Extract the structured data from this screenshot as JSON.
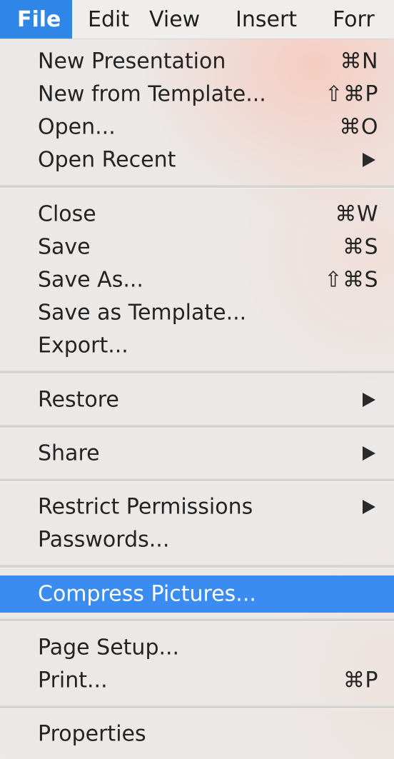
{
  "menubar": {
    "items": [
      "File",
      "Edit",
      "View",
      "Insert",
      "Forr"
    ]
  },
  "file_menu": {
    "new_presentation": {
      "label": "New Presentation",
      "shortcut": "⌘N"
    },
    "new_from_template": {
      "label": "New from Template...",
      "shortcut": "⇧⌘P"
    },
    "open": {
      "label": "Open...",
      "shortcut": "⌘O"
    },
    "open_recent": {
      "label": "Open Recent"
    },
    "close": {
      "label": "Close",
      "shortcut": "⌘W"
    },
    "save": {
      "label": "Save",
      "shortcut": "⌘S"
    },
    "save_as": {
      "label": "Save As...",
      "shortcut": "⇧⌘S"
    },
    "save_as_template": {
      "label": "Save as Template..."
    },
    "export": {
      "label": "Export..."
    },
    "restore": {
      "label": "Restore"
    },
    "share": {
      "label": "Share"
    },
    "restrict_permissions": {
      "label": "Restrict Permissions"
    },
    "passwords": {
      "label": "Passwords..."
    },
    "compress_pictures": {
      "label": "Compress Pictures..."
    },
    "page_setup": {
      "label": "Page Setup..."
    },
    "print": {
      "label": "Print...",
      "shortcut": "⌘P"
    },
    "properties": {
      "label": "Properties"
    }
  },
  "colors": {
    "highlight": "#3a8cf1",
    "active_menu": "#2f86e7"
  }
}
